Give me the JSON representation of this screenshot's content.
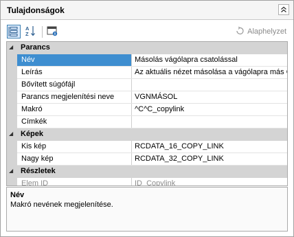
{
  "panel": {
    "title": "Tulajdonságok"
  },
  "toolbar": {
    "reset_label": "Alaphelyzet"
  },
  "categories": [
    {
      "name": "Parancs",
      "rows": [
        {
          "name": "Név",
          "value": "Másolás vágólapra csatolással"
        },
        {
          "name": "Leírás",
          "value": "Az aktuális nézet másolása a vágólapra más OLE"
        },
        {
          "name": "Bővített súgófájl",
          "value": ""
        },
        {
          "name": "Parancs megjelenítési neve",
          "value": "VGNMÁSOL"
        },
        {
          "name": "Makró",
          "value": "^C^C_copylink"
        },
        {
          "name": "Címkék",
          "value": ""
        }
      ]
    },
    {
      "name": "Képek",
      "rows": [
        {
          "name": "Kis kép",
          "value": "RCDATA_16_COPY_LINK"
        },
        {
          "name": "Nagy kép",
          "value": "RCDATA_32_COPY_LINK"
        }
      ]
    },
    {
      "name": "Részletek",
      "rows": [
        {
          "name": "Elem ID",
          "value": "ID_Copylink"
        }
      ]
    }
  ],
  "description": {
    "title": "Név",
    "text": "Makró nevének megjelenítése."
  },
  "colors": {
    "selection": "#3e8ed0",
    "category_bg": "#d4d4d4",
    "active_button": "#dcebfc"
  },
  "icons": [
    "categorized-view-icon",
    "sort-az-icon",
    "property-pages-icon",
    "reset-icon",
    "collapse-chevrons-icon",
    "expand-collapse-triangle-icon"
  ]
}
